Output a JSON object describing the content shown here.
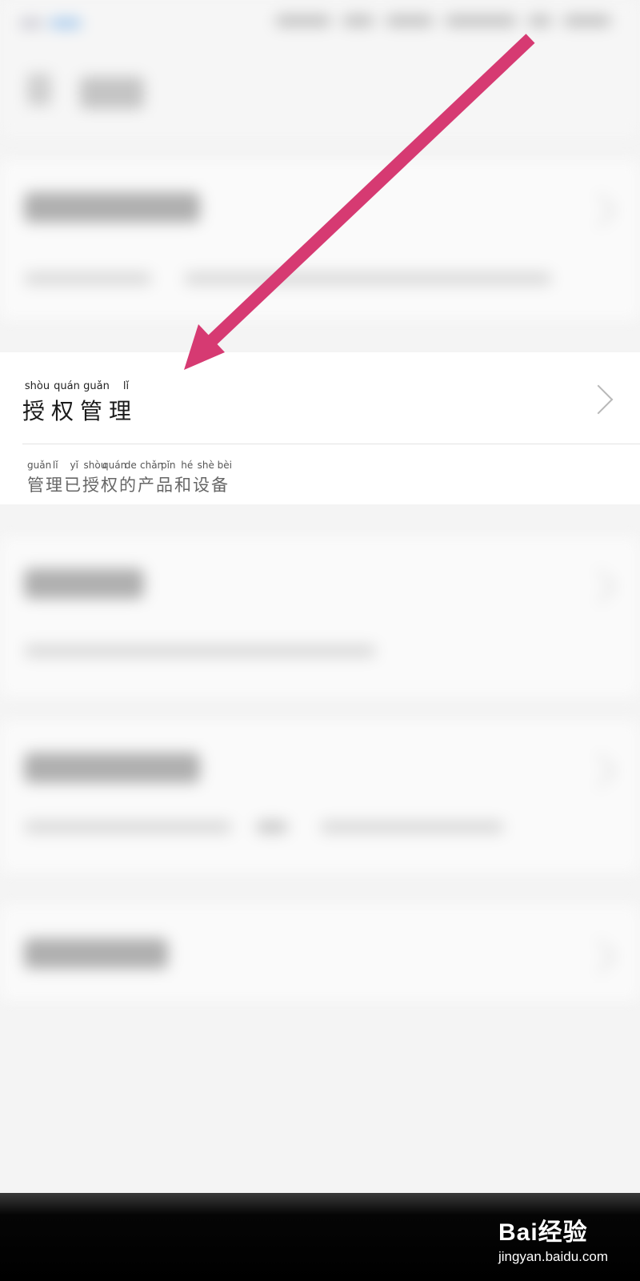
{
  "focus_item": {
    "title_pinyin": [
      "shòu",
      "quán",
      "guǎn",
      "lǐ"
    ],
    "title_chars": "授权管理",
    "desc_pinyin": [
      "guǎn",
      "lǐ",
      "yǐ",
      "shòu",
      "quán",
      "de",
      "chǎn",
      "pǐn",
      "hé",
      "shè",
      "bèi"
    ],
    "desc_chars": "管理已授权的产品和设备"
  },
  "watermark": {
    "brand": "Bai经验",
    "url": "jingyan.baidu.com"
  },
  "colors": {
    "arrow": "#d63a72",
    "background": "#f4f4f4",
    "card": "#ffffff"
  },
  "icons": {
    "chevron": "chevron-right-icon",
    "annotation": "pink-arrow"
  }
}
